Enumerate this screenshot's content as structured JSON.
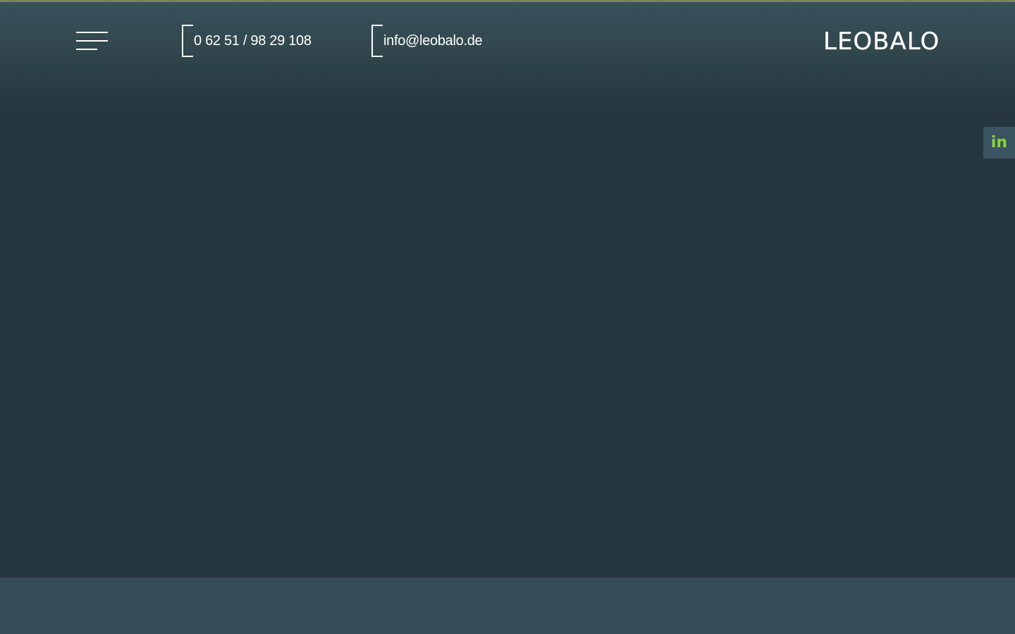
{
  "header": {
    "menu_icon": "hamburger-menu-icon",
    "phone": "0 62 51 / 98 29 108",
    "email": "info@leobalo.de",
    "logo": "LEOBALO"
  },
  "social": {
    "linkedin_label": "in",
    "linkedin_icon": "linkedin-icon",
    "linkedin_color": "#8bd43c"
  },
  "colors": {
    "background": "#263640",
    "header_top": "#36505d",
    "footer_band": "#354c58",
    "accent": "#8bd43c"
  }
}
